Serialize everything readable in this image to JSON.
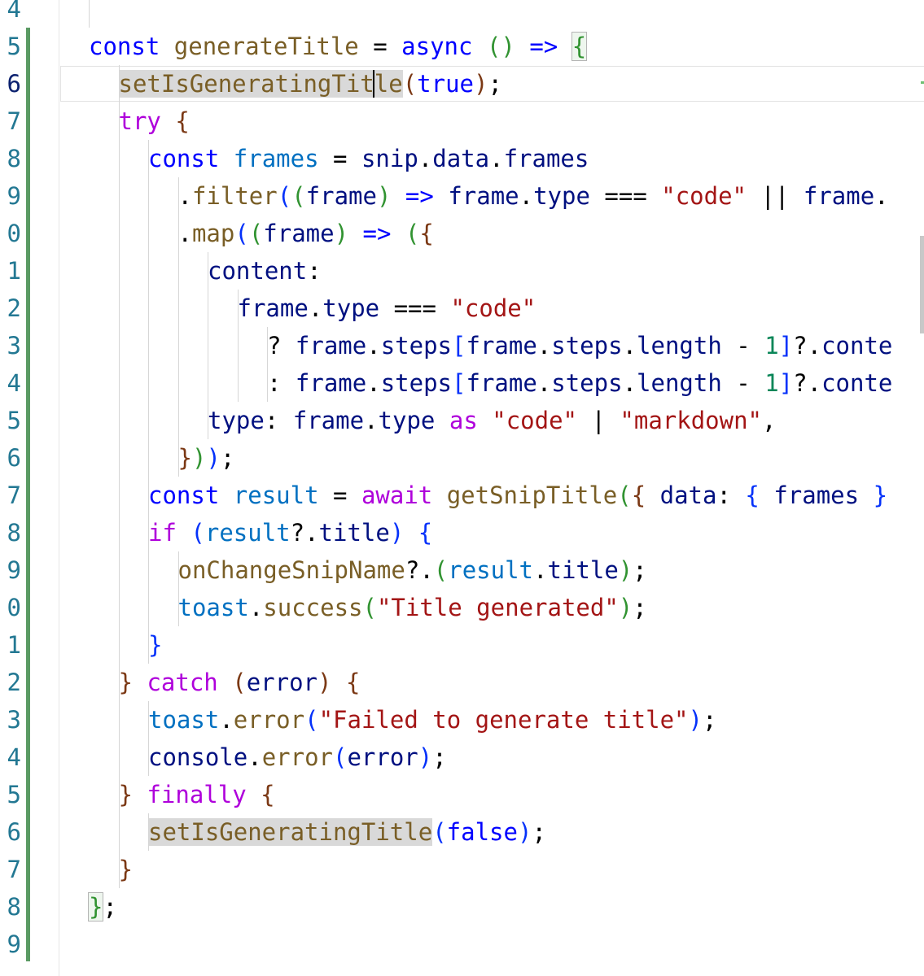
{
  "editor": {
    "gutter": {
      "line_numbers": [
        "4",
        "5",
        "6",
        "7",
        "8",
        "9",
        "0",
        "1",
        "2",
        "3",
        "4",
        "5",
        "6",
        "7",
        "8",
        "9",
        "0",
        "1",
        "2",
        "3",
        "4",
        "5",
        "6",
        "7",
        "8",
        "9",
        ""
      ]
    },
    "lines": [
      {
        "indent": 0,
        "tokens": []
      },
      {
        "indent": 1,
        "tokens": [
          {
            "t": "const",
            "c": "kw"
          },
          {
            "t": " "
          },
          {
            "t": "generateTitle",
            "c": "fn"
          },
          {
            "t": " = "
          },
          {
            "t": "async",
            "c": "kw"
          },
          {
            "t": " "
          },
          {
            "t": "()",
            "c": "p1"
          },
          {
            "t": " "
          },
          {
            "t": "=>",
            "c": "kw"
          },
          {
            "t": " "
          },
          {
            "t": "{",
            "c": "p1 bm"
          }
        ]
      },
      {
        "indent": 2,
        "tokens": [
          {
            "t": "setIsGeneratingTitle",
            "c": "fn hl"
          },
          {
            "t": "(",
            "c": "p2"
          },
          {
            "t": "true",
            "c": "kw"
          },
          {
            "t": ")",
            "c": "p2"
          },
          {
            "t": ";"
          }
        ]
      },
      {
        "indent": 2,
        "tokens": [
          {
            "t": "try",
            "c": "ctl"
          },
          {
            "t": " "
          },
          {
            "t": "{",
            "c": "p2"
          }
        ]
      },
      {
        "indent": 3,
        "tokens": [
          {
            "t": "const",
            "c": "kw"
          },
          {
            "t": " "
          },
          {
            "t": "frames",
            "c": "cst"
          },
          {
            "t": " = "
          },
          {
            "t": "snip",
            "c": "var"
          },
          {
            "t": "."
          },
          {
            "t": "data",
            "c": "var"
          },
          {
            "t": "."
          },
          {
            "t": "frames",
            "c": "var"
          }
        ]
      },
      {
        "indent": 4,
        "tokens": [
          {
            "t": "."
          },
          {
            "t": "filter",
            "c": "fn"
          },
          {
            "t": "(",
            "c": "p3"
          },
          {
            "t": "(",
            "c": "p1"
          },
          {
            "t": "frame",
            "c": "var"
          },
          {
            "t": ")",
            "c": "p1"
          },
          {
            "t": " "
          },
          {
            "t": "=>",
            "c": "kw"
          },
          {
            "t": " "
          },
          {
            "t": "frame",
            "c": "var"
          },
          {
            "t": "."
          },
          {
            "t": "type",
            "c": "var"
          },
          {
            "t": " === "
          },
          {
            "t": "\"code\"",
            "c": "str"
          },
          {
            "t": " || "
          },
          {
            "t": "frame",
            "c": "var"
          },
          {
            "t": "."
          }
        ]
      },
      {
        "indent": 4,
        "tokens": [
          {
            "t": "."
          },
          {
            "t": "map",
            "c": "fn"
          },
          {
            "t": "(",
            "c": "p3"
          },
          {
            "t": "(",
            "c": "p1"
          },
          {
            "t": "frame",
            "c": "var"
          },
          {
            "t": ")",
            "c": "p1"
          },
          {
            "t": " "
          },
          {
            "t": "=>",
            "c": "kw"
          },
          {
            "t": " "
          },
          {
            "t": "(",
            "c": "p1"
          },
          {
            "t": "{",
            "c": "p2"
          }
        ]
      },
      {
        "indent": 5,
        "tokens": [
          {
            "t": "content",
            "c": "var"
          },
          {
            "t": ":"
          }
        ]
      },
      {
        "indent": 6,
        "tokens": [
          {
            "t": "frame",
            "c": "var"
          },
          {
            "t": "."
          },
          {
            "t": "type",
            "c": "var"
          },
          {
            "t": " === "
          },
          {
            "t": "\"code\"",
            "c": "str"
          }
        ]
      },
      {
        "indent": 7,
        "tokens": [
          {
            "t": "? "
          },
          {
            "t": "frame",
            "c": "var"
          },
          {
            "t": "."
          },
          {
            "t": "steps",
            "c": "var"
          },
          {
            "t": "[",
            "c": "p3"
          },
          {
            "t": "frame",
            "c": "var"
          },
          {
            "t": "."
          },
          {
            "t": "steps",
            "c": "var"
          },
          {
            "t": "."
          },
          {
            "t": "length",
            "c": "var"
          },
          {
            "t": " - "
          },
          {
            "t": "1",
            "c": "num"
          },
          {
            "t": "]",
            "c": "p3"
          },
          {
            "t": "?."
          },
          {
            "t": "conte",
            "c": "var"
          }
        ]
      },
      {
        "indent": 7,
        "tokens": [
          {
            "t": ": "
          },
          {
            "t": "frame",
            "c": "var"
          },
          {
            "t": "."
          },
          {
            "t": "steps",
            "c": "var"
          },
          {
            "t": "[",
            "c": "p3"
          },
          {
            "t": "frame",
            "c": "var"
          },
          {
            "t": "."
          },
          {
            "t": "steps",
            "c": "var"
          },
          {
            "t": "."
          },
          {
            "t": "length",
            "c": "var"
          },
          {
            "t": " - "
          },
          {
            "t": "1",
            "c": "num"
          },
          {
            "t": "]",
            "c": "p3"
          },
          {
            "t": "?."
          },
          {
            "t": "conte",
            "c": "var"
          }
        ]
      },
      {
        "indent": 5,
        "tokens": [
          {
            "t": "type",
            "c": "var"
          },
          {
            "t": ": "
          },
          {
            "t": "frame",
            "c": "var"
          },
          {
            "t": "."
          },
          {
            "t": "type",
            "c": "var"
          },
          {
            "t": " "
          },
          {
            "t": "as",
            "c": "ctl"
          },
          {
            "t": " "
          },
          {
            "t": "\"code\"",
            "c": "str"
          },
          {
            "t": " | "
          },
          {
            "t": "\"markdown\"",
            "c": "str"
          },
          {
            "t": ","
          }
        ]
      },
      {
        "indent": 4,
        "tokens": [
          {
            "t": "}",
            "c": "p2"
          },
          {
            "t": ")",
            "c": "p1"
          },
          {
            "t": ")",
            "c": "p3"
          },
          {
            "t": ";"
          }
        ]
      },
      {
        "indent": 3,
        "tokens": [
          {
            "t": "const",
            "c": "kw"
          },
          {
            "t": " "
          },
          {
            "t": "result",
            "c": "cst"
          },
          {
            "t": " = "
          },
          {
            "t": "await",
            "c": "ctl"
          },
          {
            "t": " "
          },
          {
            "t": "getSnipTitle",
            "c": "fn"
          },
          {
            "t": "(",
            "c": "p1"
          },
          {
            "t": "{",
            "c": "p2"
          },
          {
            "t": " "
          },
          {
            "t": "data",
            "c": "var"
          },
          {
            "t": ": "
          },
          {
            "t": "{",
            "c": "p3"
          },
          {
            "t": " "
          },
          {
            "t": "frames",
            "c": "var"
          },
          {
            "t": " "
          },
          {
            "t": "}",
            "c": "p3"
          }
        ]
      },
      {
        "indent": 3,
        "tokens": [
          {
            "t": "if",
            "c": "ctl"
          },
          {
            "t": " "
          },
          {
            "t": "(",
            "c": "p3"
          },
          {
            "t": "result",
            "c": "cst"
          },
          {
            "t": "?."
          },
          {
            "t": "title",
            "c": "var"
          },
          {
            "t": ")",
            "c": "p3"
          },
          {
            "t": " "
          },
          {
            "t": "{",
            "c": "p3"
          }
        ]
      },
      {
        "indent": 4,
        "tokens": [
          {
            "t": "onChangeSnipName",
            "c": "fn"
          },
          {
            "t": "?."
          },
          {
            "t": "(",
            "c": "p1"
          },
          {
            "t": "result",
            "c": "cst"
          },
          {
            "t": "."
          },
          {
            "t": "title",
            "c": "var"
          },
          {
            "t": ")",
            "c": "p1"
          },
          {
            "t": ";"
          }
        ]
      },
      {
        "indent": 4,
        "tokens": [
          {
            "t": "toast",
            "c": "cst"
          },
          {
            "t": "."
          },
          {
            "t": "success",
            "c": "fn"
          },
          {
            "t": "(",
            "c": "p1"
          },
          {
            "t": "\"Title generated\"",
            "c": "str"
          },
          {
            "t": ")",
            "c": "p1"
          },
          {
            "t": ";"
          }
        ]
      },
      {
        "indent": 3,
        "tokens": [
          {
            "t": "}",
            "c": "p3"
          }
        ]
      },
      {
        "indent": 2,
        "tokens": [
          {
            "t": "}",
            "c": "p2"
          },
          {
            "t": " "
          },
          {
            "t": "catch",
            "c": "ctl"
          },
          {
            "t": " "
          },
          {
            "t": "(",
            "c": "p2"
          },
          {
            "t": "error",
            "c": "var"
          },
          {
            "t": ")",
            "c": "p2"
          },
          {
            "t": " "
          },
          {
            "t": "{",
            "c": "p2"
          }
        ]
      },
      {
        "indent": 3,
        "tokens": [
          {
            "t": "toast",
            "c": "cst"
          },
          {
            "t": "."
          },
          {
            "t": "error",
            "c": "fn"
          },
          {
            "t": "(",
            "c": "p3"
          },
          {
            "t": "\"Failed to generate title\"",
            "c": "str"
          },
          {
            "t": ")",
            "c": "p3"
          },
          {
            "t": ";"
          }
        ]
      },
      {
        "indent": 3,
        "tokens": [
          {
            "t": "console",
            "c": "var"
          },
          {
            "t": "."
          },
          {
            "t": "error",
            "c": "fn"
          },
          {
            "t": "(",
            "c": "p3"
          },
          {
            "t": "error",
            "c": "var"
          },
          {
            "t": ")",
            "c": "p3"
          },
          {
            "t": ";"
          }
        ]
      },
      {
        "indent": 2,
        "tokens": [
          {
            "t": "}",
            "c": "p2"
          },
          {
            "t": " "
          },
          {
            "t": "finally",
            "c": "ctl"
          },
          {
            "t": " "
          },
          {
            "t": "{",
            "c": "p2"
          }
        ]
      },
      {
        "indent": 3,
        "tokens": [
          {
            "t": "setIsGeneratingTitle",
            "c": "fn hl"
          },
          {
            "t": "(",
            "c": "p3"
          },
          {
            "t": "false",
            "c": "kw"
          },
          {
            "t": ")",
            "c": "p3"
          },
          {
            "t": ";"
          }
        ]
      },
      {
        "indent": 2,
        "tokens": [
          {
            "t": "}",
            "c": "p2"
          }
        ]
      },
      {
        "indent": 1,
        "tokens": [
          {
            "t": "}",
            "c": "p1 bm"
          },
          {
            "t": ";"
          }
        ]
      },
      {
        "indent": 0,
        "tokens": []
      },
      {
        "indent": 2,
        "tokens": []
      }
    ],
    "colors": {
      "line_number": "#237893",
      "keyword": "#0000ff",
      "control": "#af00db",
      "function": "#795e26",
      "variable": "#001080",
      "constant": "#0070c1",
      "string": "#a31515",
      "number": "#098658",
      "change_bar": "#5a9a63"
    }
  }
}
